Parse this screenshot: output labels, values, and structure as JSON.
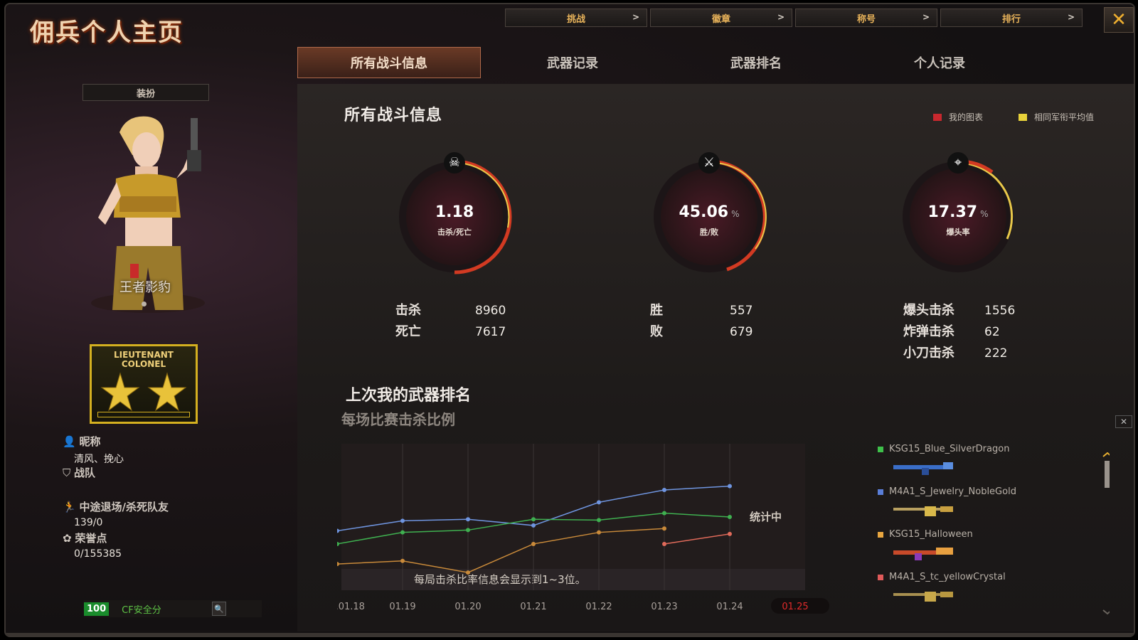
{
  "header": {
    "title": "佣兵个人主页"
  },
  "topnav": [
    {
      "label": "挑战",
      "chev": ">"
    },
    {
      "label": "徽章",
      "chev": ">"
    },
    {
      "label": "称号",
      "chev": ">"
    },
    {
      "label": "排行",
      "chev": ">"
    }
  ],
  "close_label": "✕",
  "tabs": [
    {
      "label": "所有战斗信息",
      "active": true
    },
    {
      "label": "武器记录"
    },
    {
      "label": "武器排名"
    },
    {
      "label": "个人记录"
    }
  ],
  "left": {
    "outfit_label": "装扮",
    "character_name": "王者影豹",
    "rank": {
      "line1": "LIEUTENANT",
      "line2": "COLONEL"
    },
    "nickname_label": "昵称",
    "nickname": "清风、挽心",
    "team_label": "战队",
    "quit_label": "中途退场/杀死队友",
    "quit_value": "139/0",
    "honor_label": "荣誉点",
    "honor_value": "0/155385",
    "security_score": "100",
    "security_label": "CF安全分"
  },
  "main": {
    "title": "所有战斗信息",
    "legend": [
      {
        "label": "我的图表",
        "color": "#c8282e"
      },
      {
        "label": "相同军衔平均值",
        "color": "#e8d23a"
      }
    ],
    "gauges": [
      {
        "value": "1.18",
        "unit": "",
        "label": "击杀/死亡",
        "icon": "skull-icon",
        "fraction": 0.55
      },
      {
        "value": "45.06",
        "unit": "%",
        "label": "胜/败",
        "icon": "crossed-guns-icon",
        "fraction": 0.4506
      },
      {
        "value": "17.37",
        "unit": "%",
        "label": "爆头率",
        "icon": "headshot-icon",
        "fraction": 0.1737
      }
    ],
    "stats": {
      "kills_label": "击杀",
      "kills": "8960",
      "deaths_label": "死亡",
      "deaths": "7617",
      "wins_label": "胜",
      "wins": "557",
      "losses_label": "败",
      "losses": "679",
      "headshot_label": "爆头击杀",
      "headshot": "1556",
      "grenade_label": "炸弹击杀",
      "grenade": "62",
      "knife_label": "小刀击杀",
      "knife": "222"
    },
    "weapon_rank_title": "上次我的武器排名",
    "kill_ratio_title": "每场比赛击杀比例",
    "counting_label": "统计中",
    "chart_note": "每局击杀比率信息会显示到1~3位。",
    "weapons": [
      {
        "name": "KSG15_Blue_SilverDragon",
        "color": "#3ec04a"
      },
      {
        "name": "M4A1_S_Jewelry_NobleGold",
        "color": "#5a7ed8"
      },
      {
        "name": "KSG15_Halloween",
        "color": "#e8a640"
      },
      {
        "name": "M4A1_S_tc_yellowCrystal",
        "color": "#e05a5a"
      }
    ]
  },
  "chart_data": {
    "type": "line",
    "x": [
      "25.01.18",
      "01.19",
      "01.20",
      "01.21",
      "01.22",
      "01.23",
      "01.24",
      "01.25"
    ],
    "selected": "01.25",
    "series": [
      {
        "name": "M4A1_S_Jewelry_NobleGold",
        "color": "#6f95e0",
        "values": [
          0.37,
          0.5,
          0.52,
          0.44,
          0.74,
          0.9,
          0.95,
          null
        ]
      },
      {
        "name": "KSG15_Blue_SilverDragon",
        "color": "#3fb050",
        "values": [
          0.2,
          0.35,
          0.38,
          0.52,
          0.51,
          0.6,
          0.55,
          null
        ]
      },
      {
        "name": "KSG15_Halloween",
        "color": "#c98a3a",
        "values": [
          -0.06,
          -0.02,
          -0.17,
          0.2,
          0.35,
          0.4,
          null,
          null
        ]
      },
      {
        "name": "M4A1_S_tc_yellowCrystal",
        "color": "#e06a5a",
        "values": [
          null,
          null,
          null,
          null,
          null,
          0.2,
          0.33,
          null
        ]
      }
    ],
    "ylim": [
      -0.4,
      1.5
    ]
  }
}
